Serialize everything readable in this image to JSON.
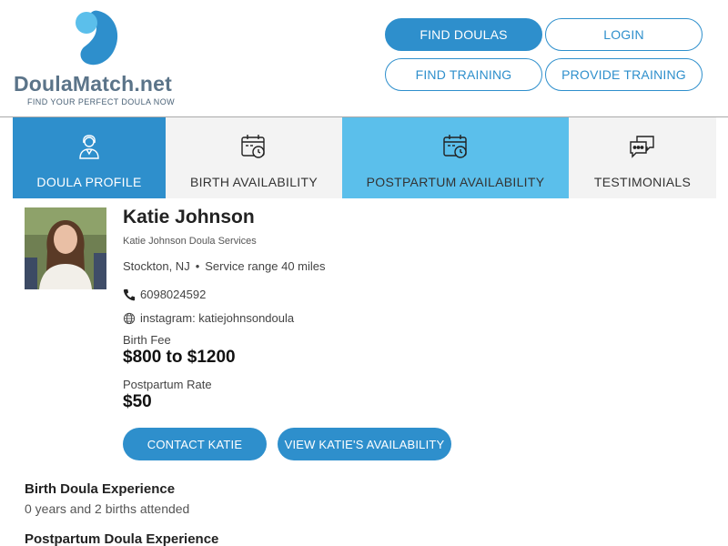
{
  "brand": {
    "name": "DoulaMatch.net",
    "tagline": "FIND YOUR PERFECT DOULA NOW",
    "colors": {
      "primary": "#2e8fcc",
      "accent": "#5bbfeb",
      "logo_text": "#5b7489"
    }
  },
  "nav": {
    "find_doulas": "FIND DOULAS",
    "login": "LOGIN",
    "find_training": "FIND TRAINING",
    "provide_training": "PROVIDE TRAINING"
  },
  "tabs": [
    {
      "label": "DOULA PROFILE",
      "icon": "doula-person-icon",
      "active": true
    },
    {
      "label": "BIRTH AVAILABILITY",
      "icon": "calendar-clock-icon"
    },
    {
      "label": "POSTPARTUM AVAILABILITY",
      "icon": "calendar-clock-icon",
      "highlighted": true
    },
    {
      "label": "TESTIMONIALS",
      "icon": "chat-bubbles-icon"
    }
  ],
  "profile": {
    "name": "Katie Johnson",
    "business": "Katie Johnson Doula Services",
    "city": "Stockton, NJ",
    "service_range": "Service range 40 miles",
    "phone": "6098024592",
    "website": "instagram: katiejohnsondoula",
    "birth_fee_label": "Birth Fee",
    "birth_fee": "$800 to $1200",
    "postpartum_rate_label": "Postpartum Rate",
    "postpartum_rate": "$50"
  },
  "actions": {
    "contact": "CONTACT KATIE",
    "availability": "VIEW KATIE'S AVAILABILITY"
  },
  "sections": {
    "birth_title": "Birth Doula Experience",
    "birth_text": "0 years and 2 births attended",
    "postpartum_title": "Postpartum Doula Experience"
  }
}
